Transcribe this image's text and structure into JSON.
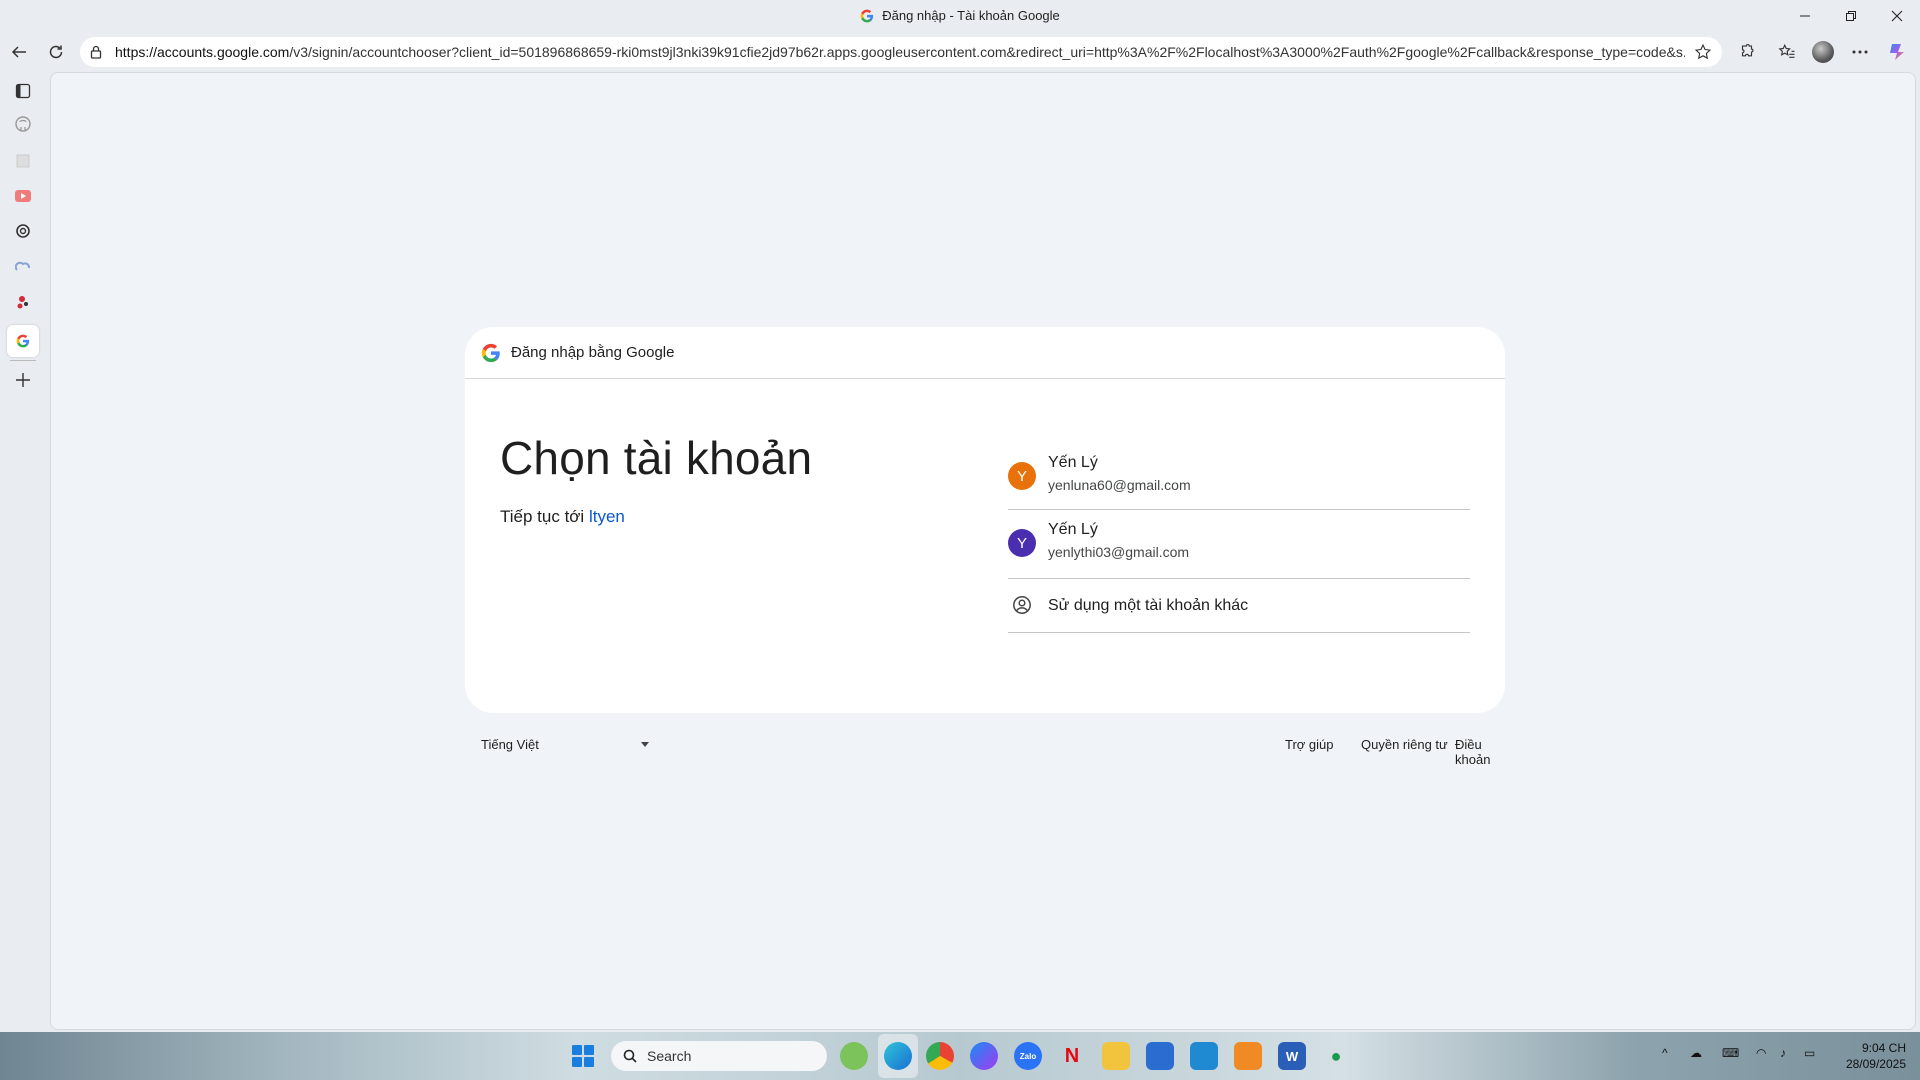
{
  "window": {
    "title": "Đăng nhập - Tài khoản Google"
  },
  "toolbar": {
    "url_host": "https://accounts.google.com",
    "url_rest": "/v3/signin/accountchooser?client_id=501896868659-rki0mst9jl3nki39k91cfie2jd97b62r.apps.googleusercontent.com&redirect_uri=http%3A%2F%2Flocalhost%3A3000%2Fauth%2Fgoogle%2Fcallback&response_type=code&s..."
  },
  "card": {
    "header": "Đăng nhập bằng Google",
    "heading": "Chọn tài khoản",
    "subtitle_prefix": "Tiếp tục tới",
    "app_name": "ltyen",
    "accounts": [
      {
        "initial": "Y",
        "name": "Yến Lý",
        "email": "yenluna60@gmail.com",
        "color": "#e8710a"
      },
      {
        "initial": "Y",
        "name": "Yến Lý",
        "email": "yenlythi03@gmail.com",
        "color": "#4a2eb0"
      }
    ],
    "other_account": "Sử dụng một tài khoản khác"
  },
  "footer": {
    "language": "Tiếng Việt",
    "help": "Trợ giúp",
    "privacy": "Quyền riêng tư",
    "terms": "Điều khoản"
  },
  "taskbar": {
    "search_placeholder": "Search",
    "time": "9:04 CH",
    "date": "28/09/2025"
  }
}
